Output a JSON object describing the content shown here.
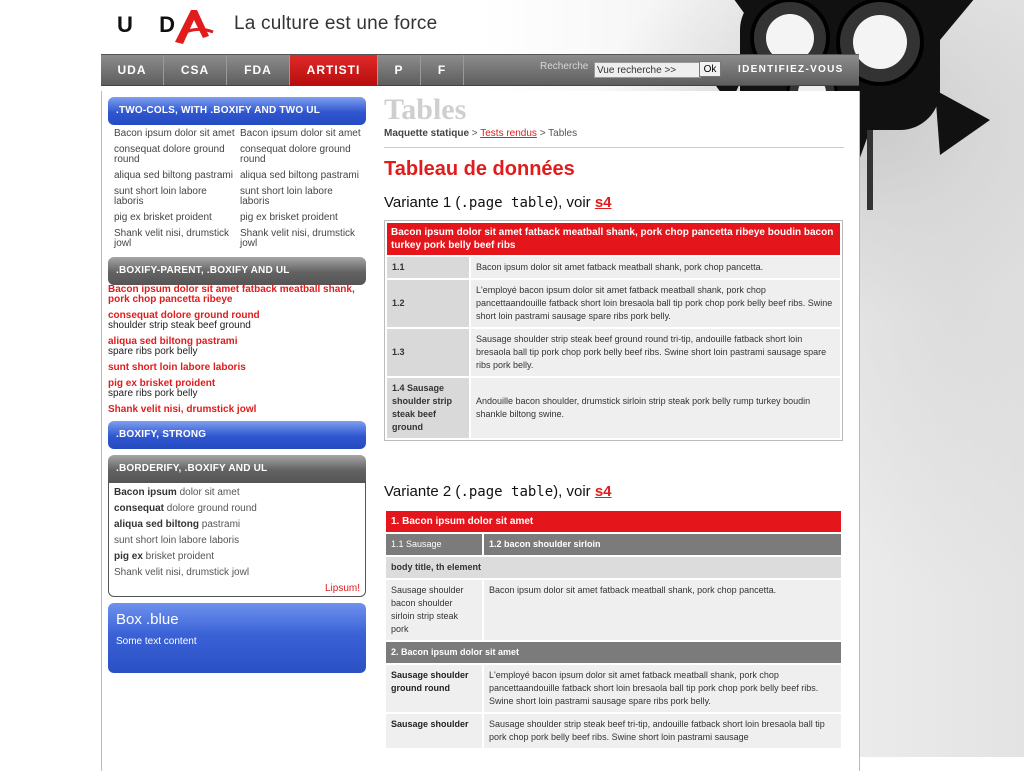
{
  "header": {
    "logo_text": "UDA",
    "tagline": "La culture est une force"
  },
  "nav": {
    "items": [
      "UDA",
      "CSA",
      "FDA",
      "ARTISTI",
      "P",
      "F"
    ],
    "search_label": "Recherche",
    "search_value": "Vue recherche >>",
    "search_button": "Ok",
    "login": "IDENTIFIEZ-VOUS"
  },
  "sidebar": {
    "box1": {
      "title": ".TWO-COLS, WITH .BOXIFY AND TWO UL",
      "col1": [
        "Bacon ipsum dolor sit amet",
        "consequat dolore ground round",
        "aliqua sed biltong pastrami",
        "sunt short loin labore laboris",
        "pig ex brisket proident",
        "Shank velit nisi, drumstick jowl"
      ],
      "col2": [
        "Bacon ipsum dolor sit amet",
        "consequat dolore ground round",
        "aliqua sed biltong pastrami",
        "sunt short loin labore laboris",
        "pig ex brisket proident",
        "Shank velit nisi, drumstick jowl"
      ]
    },
    "box2": {
      "title": ".BOXIFY-PARENT, .BOXIFY AND UL",
      "items": [
        {
          "red": "Bacon ipsum dolor sit amet fatback meatball shank, pork chop pancetta ribeye",
          "black": ""
        },
        {
          "red": "consequat dolore ground round",
          "black": "shoulder strip steak beef ground"
        },
        {
          "red": "aliqua sed biltong pastrami",
          "black": "spare ribs pork belly"
        },
        {
          "red": "sunt short loin labore laboris",
          "black": ""
        },
        {
          "red": "pig ex brisket proident",
          "black": "spare ribs pork belly"
        },
        {
          "red": "Shank velit nisi, drumstick jowl",
          "black": ""
        }
      ]
    },
    "box3": {
      "title": ".BOXIFY, STRONG"
    },
    "box4": {
      "title": ".BORDERIFY, .BOXIFY AND UL",
      "items": [
        {
          "bold": "Bacon ipsum",
          "rest": " dolor sit amet"
        },
        {
          "bold": "consequat",
          "rest": " dolore ground round"
        },
        {
          "bold": "aliqua sed biltong",
          "rest": " pastrami"
        },
        {
          "bold": "",
          "rest": "sunt short loin labore laboris"
        },
        {
          "bold": "pig ex",
          "rest": " brisket proident"
        },
        {
          "bold": "",
          "rest": "Shank velit nisi, drumstick jowl"
        }
      ],
      "footer_link": "Lipsum!"
    },
    "box5": {
      "title": "Box .blue",
      "text": "Some text content"
    }
  },
  "main": {
    "title": "Tables",
    "breadcrumb": {
      "root": "Maquette statique",
      "sep": " > ",
      "link": "Tests rendus",
      "current": "Tables"
    },
    "heading": "Tableau de données",
    "variant1": {
      "prefix": "Variante 1 (",
      "code": ".page table",
      "mid": "), voir ",
      "link": "s4"
    },
    "table1": {
      "caption": "Bacon ipsum dolor sit amet fatback meatball shank, pork chop pancetta ribeye boudin bacon turkey pork belly beef ribs",
      "rows": [
        {
          "k": "1.1",
          "v": "Bacon ipsum dolor sit amet fatback meatball shank, pork chop pancetta."
        },
        {
          "k": "1.2",
          "v": "L'employé bacon ipsum dolor sit amet fatback meatball shank, pork chop pancettaandouille fatback short loin bresaola ball tip pork chop pork belly beef ribs. Swine short loin pastrami sausage spare ribs pork belly."
        },
        {
          "k": "1.3",
          "v": "Sausage shoulder strip steak beef ground round tri-tip, andouille fatback short loin bresaola ball tip pork chop pork belly beef ribs. Swine short loin pastrami sausage spare ribs pork belly."
        },
        {
          "k": "1.4 Sausage shoulder strip steak beef ground",
          "v": "Andouille bacon shoulder, drumstick sirloin strip steak pork belly rump turkey boudin shankle biltong swine."
        }
      ]
    },
    "variant2": {
      "prefix": "Variante 2 (",
      "code": ".page table",
      "mid": "), voir ",
      "link": "s4"
    },
    "table2": {
      "group1": "1. Bacon ipsum dolor sit amet",
      "sub_a": "1.1 Sausage",
      "sub_b": "1.2 bacon shoulder sirloin",
      "body_title": "body title, th element",
      "row1_k": "Sausage shoulder bacon shoulder sirloin strip steak pork",
      "row1_v": "Bacon ipsum dolor sit amet fatback meatball shank, pork chop pancetta.",
      "group2": "2. Bacon ipsum dolor sit amet",
      "row2_k": "Sausage shoulder ground round",
      "row2_v": "L'employé bacon ipsum dolor sit amet fatback meatball shank, pork chop pancettaandouille fatback short loin bresaola ball tip pork chop pork belly beef ribs. Swine short loin pastrami sausage spare ribs pork belly.",
      "row3_k": "Sausage shoulder",
      "row3_v": "Sausage shoulder strip steak beef tri-tip, andouille fatback short loin bresaola ball tip pork chop pork belly beef ribs. Swine short loin pastrami sausage"
    }
  },
  "colors": {
    "accent_red": "#e5151c",
    "blue": "#2f56cf",
    "grey": "#7b7b7b"
  }
}
